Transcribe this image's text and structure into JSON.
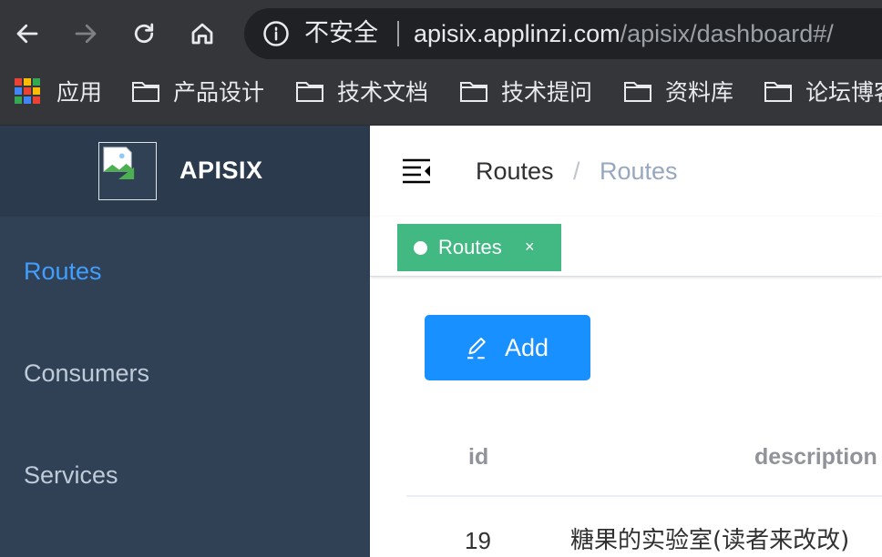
{
  "browser": {
    "insecure_label": "不安全",
    "url_host": "apisix.applinzi.com",
    "url_path": "/apisix/dashboard#/",
    "bookmarks": [
      {
        "label": "应用",
        "icon": "apps-grid-icon"
      },
      {
        "label": "产品设计",
        "icon": "folder-icon"
      },
      {
        "label": "技术文档",
        "icon": "folder-icon"
      },
      {
        "label": "技术提问",
        "icon": "folder-icon"
      },
      {
        "label": "资料库",
        "icon": "folder-icon"
      },
      {
        "label": "论坛博客",
        "icon": "folder-icon"
      }
    ]
  },
  "sidebar": {
    "title": "APISIX",
    "items": [
      {
        "label": "Routes",
        "active": true
      },
      {
        "label": "Consumers",
        "active": false
      },
      {
        "label": "Services",
        "active": false
      }
    ]
  },
  "navbar": {
    "breadcrumb": [
      "Routes",
      "Routes"
    ],
    "separator": "/"
  },
  "tags": {
    "active": {
      "label": "Routes",
      "close": "×"
    }
  },
  "main": {
    "add_label": "Add",
    "table": {
      "columns": [
        "id",
        "description"
      ],
      "rows": [
        {
          "id": "19",
          "description": "糖果的实验室(读者来改改)"
        }
      ]
    }
  },
  "colors": {
    "sidebar_bg": "#304156",
    "active_menu": "#409eff",
    "tag_bg": "#42b983",
    "primary_button": "#1890ff"
  }
}
